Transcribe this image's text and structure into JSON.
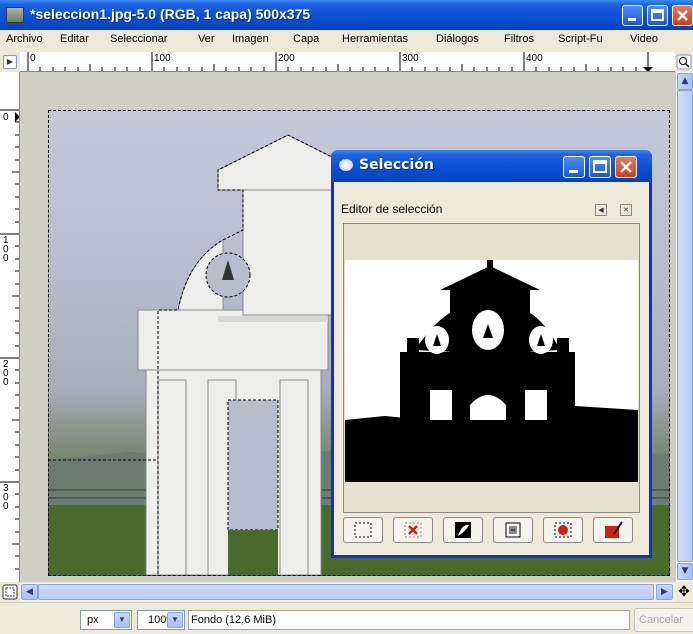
{
  "window": {
    "title": "*seleccion1.jpg-5.0 (RGB, 1 capa) 500x375"
  },
  "menu": [
    {
      "label": "Archivo"
    },
    {
      "label": "Editar"
    },
    {
      "label": "Seleccionar"
    },
    {
      "label": "Ver"
    },
    {
      "label": "Imagen"
    },
    {
      "label": "Capa"
    },
    {
      "label": "Herramientas"
    },
    {
      "label": "Diálogos"
    },
    {
      "label": "Filtros"
    },
    {
      "label": "Script-Fu"
    },
    {
      "label": "Video"
    }
  ],
  "ruler": {
    "h_labels": [
      "0",
      "100",
      "200",
      "300",
      "400"
    ],
    "v_labels": [
      "0",
      "100",
      "200",
      "300"
    ]
  },
  "status": {
    "unit": "px",
    "zoom": "100%",
    "info": "Fondo (12,6 MiB)",
    "cancel_label": "Cancelar"
  },
  "dialog": {
    "title": "Selección",
    "dock_label": "Editor de selección",
    "buttons": [
      {
        "icon": "select-all-icon"
      },
      {
        "icon": "select-none-icon"
      },
      {
        "icon": "invert-selection-icon"
      },
      {
        "icon": "selection-to-channel-icon"
      },
      {
        "icon": "selection-to-path-icon"
      },
      {
        "icon": "stroke-selection-icon"
      }
    ]
  },
  "colors": {
    "titlebar": "#0a52d8",
    "close": "#c8401c",
    "xp_face": "#ece9d8"
  }
}
